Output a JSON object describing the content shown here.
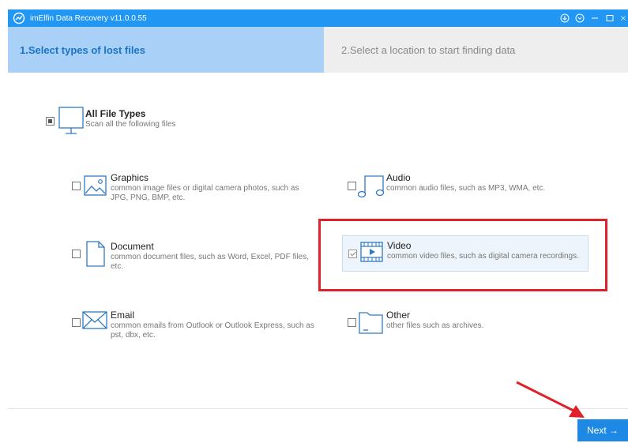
{
  "window": {
    "title": "imElfin Data Recovery v11.0.0.55",
    "accent": "#2196f3",
    "controls": [
      "download-icon",
      "dropdown-circle-icon",
      "minimize-icon",
      "maximize-icon",
      "close-icon"
    ]
  },
  "steps": [
    {
      "label": "1.Select types of lost files",
      "active": true
    },
    {
      "label": "2.Select a location to start finding data",
      "active": false
    }
  ],
  "all_types": {
    "name": "All File Types",
    "desc": "Scan all the following files",
    "state": "partial"
  },
  "types": {
    "graphics": {
      "name": "Graphics",
      "desc": "common image files or digital camera photos, such as JPG, PNG, BMP, etc.",
      "checked": false
    },
    "audio": {
      "name": "Audio",
      "desc": "common audio files, such as MP3, WMA, etc.",
      "checked": false
    },
    "document": {
      "name": "Document",
      "desc": "common document files, such as Word, Excel, PDF files, etc.",
      "checked": false
    },
    "video": {
      "name": "Video",
      "desc": "common video files, such as digital camera recordings.",
      "checked": true
    },
    "email": {
      "name": "Email",
      "desc": "common emails from Outlook or Outlook Express, such as pst, dbx, etc.",
      "checked": false
    },
    "other": {
      "name": "Other",
      "desc": "other files such as archives.",
      "checked": false
    }
  },
  "footer": {
    "next_label": "Next →"
  },
  "annotation_color": "#e0202a"
}
